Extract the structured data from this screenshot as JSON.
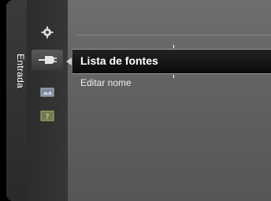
{
  "side_tab": {
    "label": "Entrada"
  },
  "icons": [
    {
      "name": "settings-gear-icon",
      "glyph": "✹"
    },
    {
      "name": "input-plug-icon",
      "glyph": "⟵",
      "active": true
    },
    {
      "name": "picture-icon",
      "glyph": "▭"
    },
    {
      "name": "help-icon",
      "glyph": "?"
    }
  ],
  "menu": {
    "items": [
      {
        "label": "Lista de fontes",
        "selected": true
      },
      {
        "label": "Editar nome",
        "selected": false
      }
    ]
  },
  "colors": {
    "highlight_bg": "#111111",
    "panel_bg": "#6a6a6a",
    "text": "#ffffff"
  }
}
